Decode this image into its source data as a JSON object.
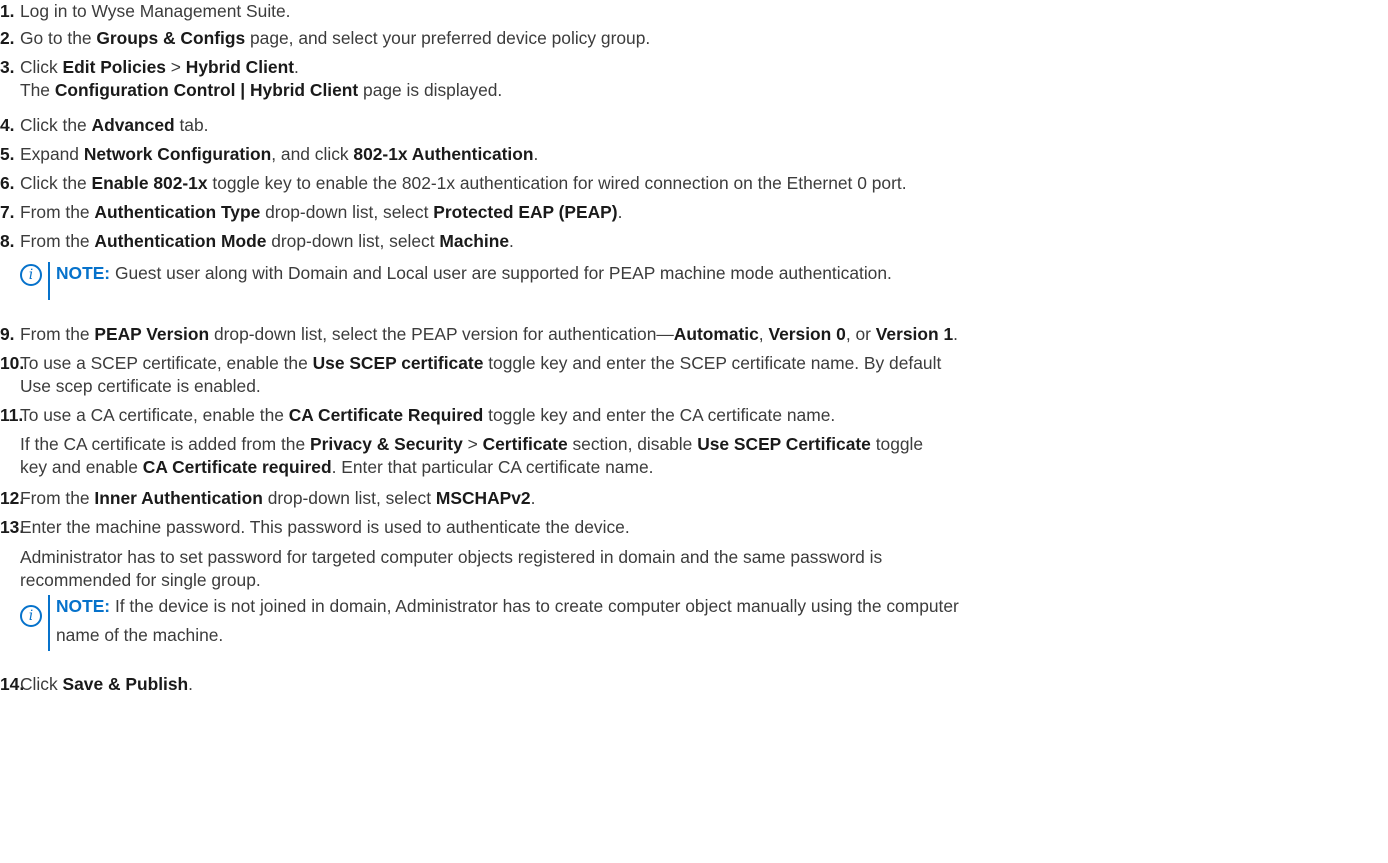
{
  "steps": [
    {
      "num": "1.",
      "parts": [
        "Log in to Wyse Management Suite."
      ]
    },
    {
      "num": "2.",
      "parts": [
        "Go to the ",
        "Groups & Configs",
        " page, and select your preferred device policy group."
      ]
    },
    {
      "num": "3.",
      "parts": [
        "Click ",
        "Edit Policies",
        " > ",
        "Hybrid Client",
        "."
      ],
      "sub": [
        "The ",
        "Configuration Control | Hybrid Client",
        " page is displayed."
      ]
    },
    {
      "num": "4.",
      "parts": [
        "Click the ",
        "Advanced",
        " tab."
      ]
    },
    {
      "num": "5.",
      "parts": [
        "Expand ",
        "Network Configuration",
        ", and click ",
        "802-1x Authentication",
        "."
      ]
    },
    {
      "num": "6.",
      "parts": [
        "Click the ",
        "Enable 802-1x",
        " toggle key to enable the 802-1x authentication for wired connection on the Ethernet 0 port."
      ]
    },
    {
      "num": "7.",
      "parts": [
        "From the ",
        "Authentication Type",
        " drop-down list, select ",
        "Protected EAP (PEAP)",
        "."
      ]
    },
    {
      "num": "8.",
      "parts": [
        "From the ",
        "Authentication Mode",
        " drop-down list, select ",
        "Machine",
        "."
      ],
      "note": {
        "label": "NOTE:",
        "text": " Guest user along with Domain and Local user are supported for PEAP machine mode authentication."
      }
    },
    {
      "num": "9.",
      "parts": [
        "From the ",
        "PEAP Version",
        " drop-down list, select the PEAP version for authentication—",
        "Automatic",
        ", ",
        "Version 0",
        ", or ",
        "Version 1",
        "."
      ]
    },
    {
      "num": "10.",
      "parts": [
        "To use a SCEP certificate, enable the ",
        "Use SCEP certificate",
        " toggle key and enter the SCEP certificate name. By default"
      ],
      "line2": "Use scep certificate is enabled."
    },
    {
      "num": "11.",
      "parts": [
        "To use a CA certificate, enable the ",
        "CA Certificate Required",
        " toggle key and enter the CA certificate name."
      ],
      "sub1": [
        "If the CA certificate is added from the ",
        "Privacy & Security",
        " > ",
        "Certificate",
        " section, disable ",
        "Use SCEP Certificate",
        " toggle"
      ],
      "sub2": [
        "key and enable ",
        "CA Certificate required",
        ". Enter that particular CA certificate name."
      ]
    },
    {
      "num": "12.",
      "parts": [
        "From the ",
        "Inner Authentication",
        " drop-down list, select ",
        "MSCHAPv2",
        "."
      ]
    },
    {
      "num": "13.",
      "parts": [
        "Enter the machine password. This password is used to authenticate the device."
      ],
      "sub1": "Administrator has to set password for targeted computer objects registered in domain and the same password is",
      "sub2": "recommended for single group.",
      "note": {
        "label": "NOTE:",
        "text": " If the device is not joined in domain, Administrator has to create computer object manually using the computer",
        "text2": "name of the machine."
      }
    },
    {
      "num": "14.",
      "parts": [
        "Click ",
        "Save & Publish",
        "."
      ]
    }
  ]
}
